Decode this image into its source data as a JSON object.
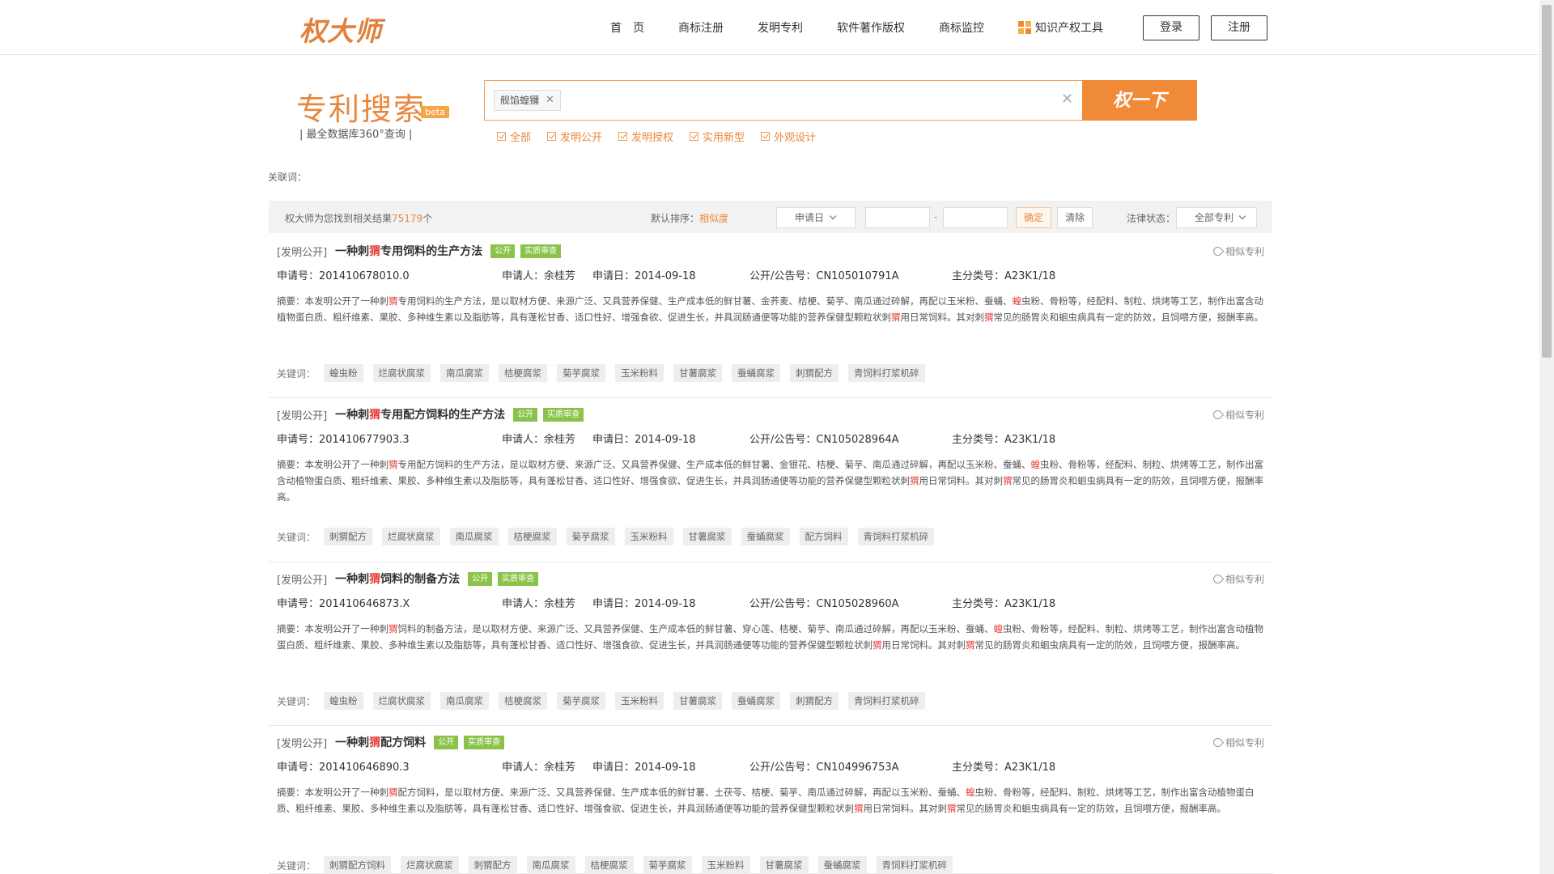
{
  "header": {
    "logo": "权大师",
    "nav": [
      "首　页",
      "商标注册",
      "发明专利",
      "软件著作版权",
      "商标监控"
    ],
    "tools_label": "知识产权工具",
    "login": "登录",
    "register": "注册"
  },
  "search": {
    "title": "专利搜索",
    "beta": "beta",
    "subtitle": "| 最全数据库360°查询 |",
    "chip": "舰馅蝗獼",
    "button": "权一下",
    "filters": [
      "全部",
      "发明公开",
      "发明授权",
      "实用新型",
      "外观设计"
    ]
  },
  "related_label": "关联词：",
  "result_bar": {
    "count_prefix": "权大师为您找到相关结果",
    "count": "75179",
    "count_suffix": "个",
    "sort_label": "默认排序：",
    "sort_value": "相似度",
    "date_select": "申请日",
    "dash": "-",
    "ok": "确定",
    "clear": "清除",
    "legal_label": "法律状态：",
    "legal_select": "全部专利"
  },
  "results": [
    {
      "type": "[发明公开]",
      "title_pre": "一种刺",
      "title_hl": "猬",
      "title_post": "专用饲料的生产方法",
      "tag1": "公开",
      "tag2": "实质审查",
      "similar": "相似专利",
      "app_no": "申请号：201410678010.0",
      "applicant": "申请人：余桂芳",
      "app_date": "申请日：2014-09-18",
      "pub_no": "公开/公告号：CN105010791A",
      "class_no": "主分类号：A23K1/18",
      "abstract": "摘要：本发明公开了一种刺猬专用饲料的生产方法，是以取材方便、来源广泛、又具营养保健、生产成本低的鲜甘薯、金荞麦、桔梗、菊芋、南瓜通过碎解，再配以玉米粉、蚕蛹、蝗虫粉、骨粉等，经配料、制粒、烘烤等工艺，制作出富含动植物蛋白质、粗纤维素、果胶、多种维生素以及脂肪等，具有蓬松甘香、适口性好、增强食欲、促进生长，并具润肠通便等功能的营养保健型颗粒状刺猬用日常饲料。其对刺猬常见的肠胃炎和蛔虫病具有一定的防效，且饲喂方便，报酬率高。",
      "kw_label": "关键词：",
      "keywords": [
        "蝗虫粉",
        "烂腐状腐浆",
        "南瓜腐浆",
        "桔梗腐浆",
        "菊芋腐浆",
        "玉米粉料",
        "甘薯腐浆",
        "蚕蛹腐浆",
        "刺猬配方",
        "青饲料打浆机碎"
      ]
    },
    {
      "type": "[发明公开]",
      "title_pre": "一种刺",
      "title_hl": "猬",
      "title_post": "专用配方饲料的生产方法",
      "tag1": "公开",
      "tag2": "实质审查",
      "similar": "相似专利",
      "app_no": "申请号：201410677903.3",
      "applicant": "申请人：余桂芳",
      "app_date": "申请日：2014-09-18",
      "pub_no": "公开/公告号：CN105028964A",
      "class_no": "主分类号：A23K1/18",
      "abstract": "摘要：本发明公开了一种刺猬专用配方饲料的生产方法，是以取材方便、来源广泛、又具营养保健、生产成本低的鲜甘薯、金银花、桔梗、菊芋、南瓜通过碎解，再配以玉米粉、蚕蛹、蝗虫粉、骨粉等，经配料、制粒、烘烤等工艺，制作出富含动植物蛋白质、粗纤维素、果胶、多种维生素以及脂肪等，具有蓬松甘香、适口性好、增强食欲、促进生长，并具润肠通便等功能的营养保健型颗粒状刺猬用日常饲料。其对刺猬常见的肠胃炎和蛔虫病具有一定的防效，且饲喂方便，报酬率高。",
      "kw_label": "关键词：",
      "keywords": [
        "刺猬配方",
        "烂腐状腐浆",
        "南瓜腐浆",
        "桔梗腐浆",
        "菊芋腐浆",
        "玉米粉料",
        "甘薯腐浆",
        "蚕蛹腐浆",
        "配方饲料",
        "青饲料打浆机碎"
      ]
    },
    {
      "type": "[发明公开]",
      "title_pre": "一种刺",
      "title_hl": "猬",
      "title_post": "饲料的制备方法",
      "tag1": "公开",
      "tag2": "实质审查",
      "similar": "相似专利",
      "app_no": "申请号：201410646873.X",
      "applicant": "申请人：余桂芳",
      "app_date": "申请日：2014-09-18",
      "pub_no": "公开/公告号：CN105028960A",
      "class_no": "主分类号：A23K1/18",
      "abstract": "摘要：本发明公开了一种刺猬饲料的制备方法，是以取材方便、来源广泛、又具营养保健、生产成本低的鲜甘薯、穿心莲、桔梗、菊芋、南瓜通过碎解，再配以玉米粉、蚕蛹、蝗虫粉、骨粉等，经配料、制粒、烘烤等工艺，制作出富含动植物蛋白质、粗纤维素、果胶、多种维生素以及脂肪等，具有蓬松甘香、适口性好、增强食欲、促进生长，并具润肠通便等功能的营养保健型颗粒状刺猬用日常饲料。其对刺猬常见的肠胃炎和蛔虫病具有一定的防效，且饲喂方便，报酬率高。",
      "kw_label": "关键词：",
      "keywords": [
        "蝗虫粉",
        "烂腐状腐浆",
        "南瓜腐浆",
        "桔梗腐浆",
        "菊芋腐浆",
        "玉米粉料",
        "甘薯腐浆",
        "蚕蛹腐浆",
        "刺猬配方",
        "青饲料打浆机碎"
      ]
    },
    {
      "type": "[发明公开]",
      "title_pre": "一种刺",
      "title_hl": "猬",
      "title_post": "配方饲料",
      "tag1": "公开",
      "tag2": "实质审查",
      "similar": "相似专利",
      "app_no": "申请号：201410646890.3",
      "applicant": "申请人：余桂芳",
      "app_date": "申请日：2014-09-18",
      "pub_no": "公开/公告号：CN104996753A",
      "class_no": "主分类号：A23K1/18",
      "abstract": "摘要：本发明公开了一种刺猬配方饲料，是以取材方便、来源广泛、又具营养保健、生产成本低的鲜甘薯、土茯苓、桔梗、菊芋、南瓜通过碎解，再配以玉米粉、蚕蛹、蝗虫粉、骨粉等，经配料、制粒、烘烤等工艺，制作出富含动植物蛋白质、粗纤维素、果胶、多种维生素以及脂肪等，具有蓬松甘香、适口性好、增强食欲、促进生长，并具润肠通便等功能的营养保健型颗粒状刺猬用日常饲料。其对刺猬常见的肠胃炎和蛔虫病具有一定的防效，且饲喂方便，报酬率高。",
      "kw_label": "关键词：",
      "keywords": [
        "刺猬配方饲料",
        "烂腐状腐浆",
        "刺猬配方",
        "南瓜腐浆",
        "桔梗腐浆",
        "菊芋腐浆",
        "玉米粉料",
        "甘薯腐浆",
        "蚕蛹腐浆",
        "青饲料打浆机碎"
      ]
    }
  ]
}
